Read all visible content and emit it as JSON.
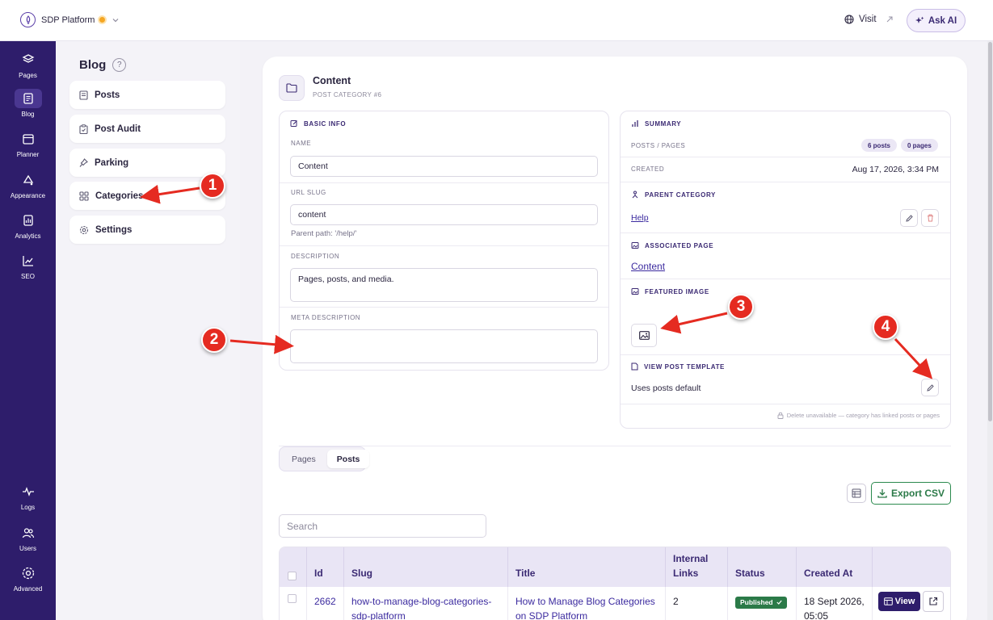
{
  "app": {
    "name": "SDP Platform",
    "visit_label": "Visit",
    "ask_ai_label": "Ask AI"
  },
  "rail": {
    "items": [
      {
        "label": "Pages",
        "icon": "layers-icon"
      },
      {
        "label": "Blog",
        "icon": "blog-icon",
        "active": true
      },
      {
        "label": "Planner",
        "icon": "planner-icon"
      },
      {
        "label": "Appearance",
        "icon": "palette-icon"
      },
      {
        "label": "Analytics",
        "icon": "analytics-icon"
      },
      {
        "label": "SEO",
        "icon": "trend-icon"
      },
      {
        "label": "Logs",
        "icon": "pulse-icon"
      },
      {
        "label": "Users",
        "icon": "users-icon"
      },
      {
        "label": "Advanced",
        "icon": "gear-icon"
      }
    ]
  },
  "subnav": {
    "title": "Blog",
    "help": "?",
    "items": [
      {
        "label": "Posts",
        "icon": "document-icon"
      },
      {
        "label": "Post Audit",
        "icon": "clipboard-icon"
      },
      {
        "label": "Parking",
        "icon": "pin-icon"
      },
      {
        "label": "Categories",
        "icon": "grid-icon"
      },
      {
        "label": "Settings",
        "icon": "gear-icon"
      }
    ]
  },
  "header": {
    "title": "Content",
    "subtitle": "POST CATEGORY #6"
  },
  "basic_info": {
    "heading": "BASIC INFO",
    "name_label": "NAME",
    "name_value": "Content",
    "slug_label": "URL SLUG",
    "slug_value": "content",
    "parent_path": "Parent path: '/help/'",
    "description_label": "DESCRIPTION",
    "description_value": "Pages, posts, and media.",
    "meta_label": "META DESCRIPTION",
    "meta_value": ""
  },
  "summary": {
    "heading": "SUMMARY",
    "posts_pages_label": "POSTS / PAGES",
    "posts_count": "6 posts",
    "pages_count": "0 pages",
    "created_label": "CREATED",
    "created_value": "Aug 17, 2026, 3:34 PM",
    "parent_heading": "PARENT CATEGORY",
    "parent_value": "Help",
    "assoc_heading": "ASSOCIATED PAGE",
    "assoc_value": "Content",
    "featured_heading": "FEATURED IMAGE",
    "template_heading": "VIEW POST TEMPLATE",
    "template_value": "Uses posts default",
    "delete_note": "Delete unavailable — category has linked posts or pages"
  },
  "tabs": [
    {
      "label": "Pages"
    },
    {
      "label": "Posts",
      "active": true
    }
  ],
  "toolbar": {
    "export_label": "Export CSV",
    "search_placeholder": "Search"
  },
  "table": {
    "columns": [
      "Id",
      "Slug",
      "Title",
      "Internal Links",
      "Status",
      "Created At"
    ],
    "rows": [
      {
        "id": "2662",
        "slug": "how-to-manage-blog-categories-sdp-platform",
        "title": "How to Manage Blog Categories on SDP Platform",
        "internal_links": "2",
        "status": "Published",
        "created_at": "18 Sept 2026, 05:05",
        "view_label": "View"
      }
    ]
  },
  "annotations": [
    "1",
    "2",
    "3",
    "4"
  ],
  "colors": {
    "sidebar": "#2e1d6b",
    "accent": "#3b2a73",
    "annotation": "#e52b21",
    "success": "#2b7a48"
  }
}
